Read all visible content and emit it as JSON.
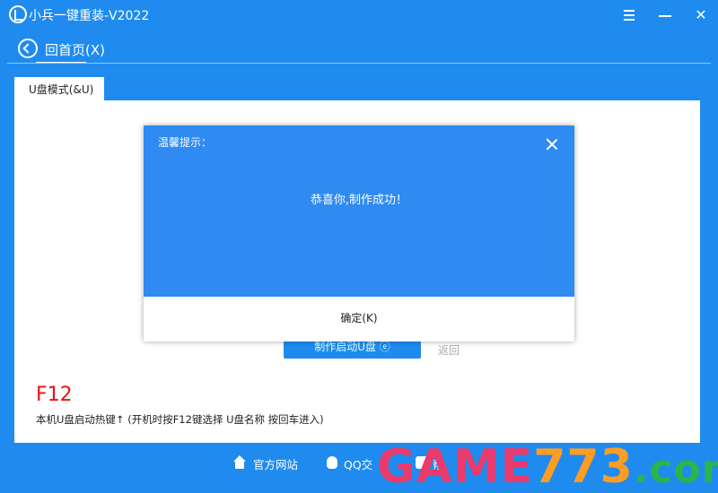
{
  "app": {
    "title": "小兵一键重装-V2022",
    "window_controls": {
      "menu": "menu-icon",
      "minimize": "minimize-icon",
      "close": "✕"
    }
  },
  "nav": {
    "back_label": "回首页(X)"
  },
  "tabs": [
    {
      "label": "U盘模式(&U)",
      "active": true
    }
  ],
  "main": {
    "make_button_label": "制作启动U盘 ⓔ",
    "return_label": "返回",
    "hotkey": "F12",
    "hotkey_desc": "本机U盘启动热键↑ (开机时按F12键选择 U盘名称 按回车进入)"
  },
  "dialog": {
    "title": "温馨提示：",
    "message": "恭喜你,制作成功！",
    "ok_label": "确定(K)"
  },
  "footer": {
    "items": [
      {
        "label": "官方网站",
        "icon": "home-icon"
      },
      {
        "label": "QQ交",
        "icon": "qq-icon"
      },
      {
        "label": "帮",
        "icon": "help-icon"
      }
    ]
  },
  "watermark": {
    "game": "GAME",
    "num": "773",
    "com": ".com"
  },
  "colors": {
    "accent": "#1f8bef",
    "dialog_header": "#2f8af2",
    "hotkey": "#e11111"
  }
}
